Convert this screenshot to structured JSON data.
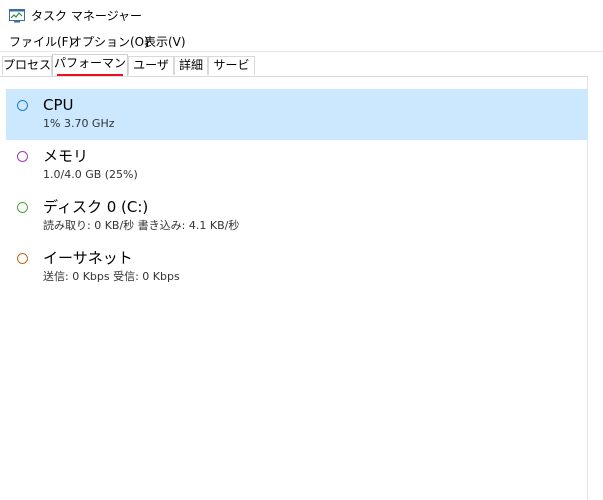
{
  "window": {
    "title": "タスク マネージャー",
    "icon": "task-manager-icon"
  },
  "menu": {
    "items": [
      "ファイル(F)",
      "オプション(O)",
      "表示(V)"
    ]
  },
  "tabs": {
    "items": [
      "プロセス",
      "パフォーマンス",
      "ユーザー",
      "詳細",
      "サービス"
    ],
    "active": "パフォーマンス",
    "active_underline_color": "#e81123"
  },
  "performance": {
    "selected": "CPU",
    "items": [
      {
        "name": "CPU",
        "detail": "1%  3.70 GHz",
        "color": "#1a7fd0"
      },
      {
        "name": "メモリ",
        "detail": "1.0/4.0 GB (25%)",
        "color": "#a33ab8"
      },
      {
        "name": "ディスク 0 (C:)",
        "detail": "読み取り: 0 KB/秒 書き込み: 4.1 KB/秒",
        "color": "#4aa83a"
      },
      {
        "name": "イーサネット",
        "detail": "送信: 0 Kbps 受信: 0 Kbps",
        "color": "#b86a23"
      }
    ]
  }
}
